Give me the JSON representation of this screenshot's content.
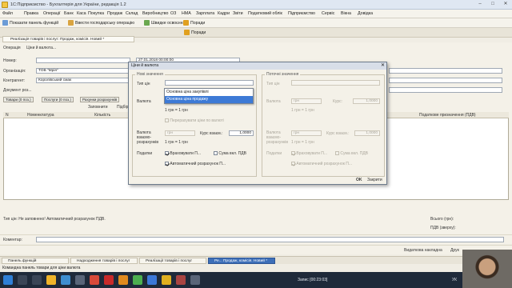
{
  "app": {
    "title": "1С:Підприємство - Бухгалтерія для України, редакція 1.2"
  },
  "menu": [
    "Файл",
    "Правка",
    "Операції",
    "Банк",
    "Каса",
    "Покупка",
    "Продаж",
    "Склад",
    "Виробництво",
    "ОЗ",
    "НМА",
    "Зарплата",
    "Кадри",
    "Звіти",
    "Податковий облік",
    "Підприємство",
    "Сервіс",
    "Вікна",
    "Довідка"
  ],
  "toolbar": {
    "show_panel": "Показати панель функцій",
    "enter_op": "Ввести господарську операцію",
    "quick_access": "Швидке освоєння",
    "tips": "Поради",
    "tips2": "Поради"
  },
  "doc_tab": "Реалізація товарів і послуг: Продаж, комісія. Новий *",
  "form": {
    "ops_label": "Операція",
    "prices_label": "Ціни й валюта...",
    "number_label": "Номер:",
    "date_value": "27.01.2018 00:00:00",
    "org_label": "Організація:",
    "org_value": "ТОВ \"Мрія\"",
    "contragent_label": "Контрагент:",
    "contragent_value": "Королівський смак",
    "docbasis_label": "Документ роз...",
    "tabs": [
      "Товари (0 поз.)",
      "Послуги (0 поз.)",
      "Рахунки розрахунків"
    ],
    "fill_btn": "Заповнити",
    "pick_btn": "Підбір",
    "grid_cols": [
      "N",
      "Номенклатура",
      "Кількість"
    ],
    "grid_col_right": "Податкове призначення (ПДВ)"
  },
  "dialog": {
    "title": "Ціни й валюта",
    "new_group": "Нові значення",
    "current_group": "Поточні значення",
    "price_type_label": "Тип цін",
    "currency_label": "Валюта",
    "currency_value": "грн",
    "course_label": "Курс:",
    "course_value": "1,0000",
    "rate_note": "1 грн = 1 грн",
    "recalc_label": "Перерахувати ціни по валюті",
    "mutual_currency_label": "Валюта взаємо-розрахунків",
    "mutual_currency_value": "грн",
    "mutual_course_label": "Курс взаєм.:",
    "mutual_course_value": "1,0000",
    "taxes_label": "Податки",
    "chk_consider": "Враховувати П...",
    "chk_incl_vat": "Сума вкл. ПДВ",
    "chk_auto_vat": "Автоматичний розрахунок П...",
    "ok_btn": "OK",
    "close_btn": "Закрити",
    "dropdown_options": [
      "Основна ціна закупівлі",
      "Основна ціна продажу"
    ],
    "dropdown_selected_index": 1
  },
  "status": {
    "left": "Тип цін: Не заповнено! Автоматичний розрахунок ПДВ.",
    "total_label": "Всього (грн):",
    "vat_label": "ПДВ (зверху):",
    "comment_label": "Коментар:",
    "invoice_label": "Видаткова накладна",
    "print_label": "Друк"
  },
  "panel_tabs": [
    "Панель функцій",
    "Надходження товарів і послуг",
    "Реалізації товарів і послуг",
    "Ре... Продаж, комісія. Новий *"
  ],
  "cmdline": "Командна панель товари для ціни валюта",
  "taskbar": {
    "record": "Запис [00:23:03]",
    "lang": "УК"
  },
  "colors": {
    "accent": "#3d7ad6",
    "form_bg": "#f4f1e8",
    "taskbar": "#1f2a3a"
  }
}
